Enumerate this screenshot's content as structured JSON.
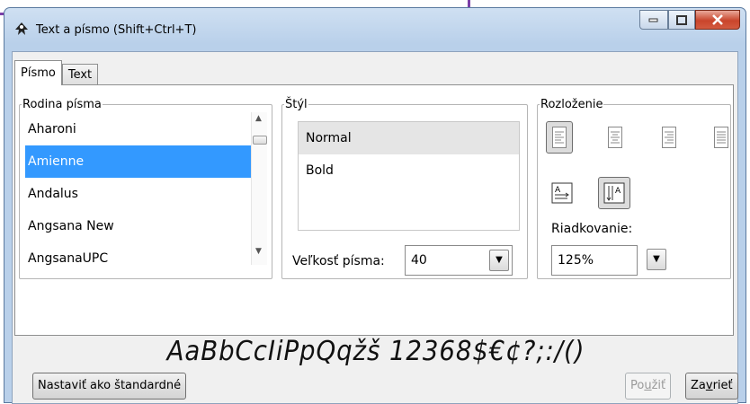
{
  "window": {
    "title": "Text a písmo (Shift+Ctrl+T)"
  },
  "tabs": [
    {
      "label": "Písmo",
      "active": true
    },
    {
      "label": "Text",
      "active": false
    }
  ],
  "font_family": {
    "legend": "Rodina písma",
    "items": [
      "Aharoni",
      "Amienne",
      "Andalus",
      "Angsana New",
      "AngsanaUPC"
    ],
    "selected": "Amienne"
  },
  "style": {
    "legend": "Štýl",
    "items": [
      "Normal",
      "Bold"
    ],
    "selected": "Normal",
    "size_label": "Veľkosť písma:",
    "size_value": "40"
  },
  "layout": {
    "legend": "Rozloženie",
    "spacing_label": "Riadkovanie:",
    "spacing_value": "125%"
  },
  "preview": {
    "text": "AaBbCcIiPpQqžš 12368$€¢?;:/()"
  },
  "buttons": {
    "set_default": "Nastaviť ako štandardné",
    "apply_prefix": "Po",
    "apply_ul": "u",
    "apply_suffix": "žiť",
    "close_prefix": "Za",
    "close_ul": "v",
    "close_suffix": "rieť"
  },
  "colors": {
    "selection": "#3399ff",
    "window_frame": "#b9d0ea",
    "close_button": "#c9452c"
  }
}
